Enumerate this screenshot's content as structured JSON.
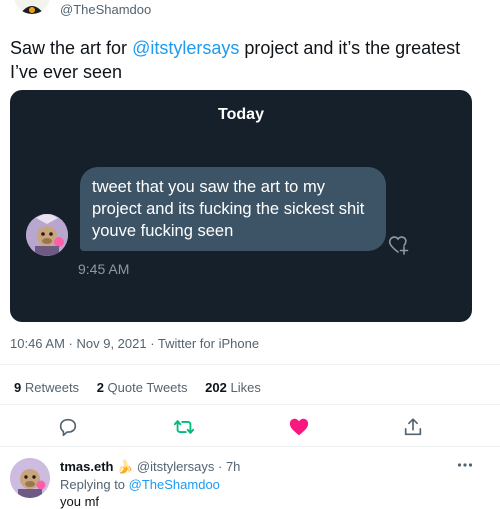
{
  "tweet": {
    "handle": "@TheShamdoo",
    "text_prefix": "Saw the art for ",
    "mention": "@itstylersays",
    "text_suffix": " project and it’s the greatest I’ve ever seen",
    "meta": "10:46 AM · Nov 9, 2021 · Twitter for iPhone"
  },
  "dm_screenshot": {
    "date_label": "Today",
    "message": "tweet that you saw the art to my project and its fucking the sickest shit youve fucking seen",
    "time": "9:45 AM"
  },
  "stats": {
    "retweets_count": "9",
    "retweets_label": "Retweets",
    "quotes_count": "2",
    "quotes_label": "Quote Tweets",
    "likes_count": "202",
    "likes_label": "Likes"
  },
  "actions": [
    "reply-icon",
    "retweet-icon",
    "like-icon",
    "share-icon"
  ],
  "colors": {
    "accent": "#1d9bf0",
    "retweet": "#00ba7c",
    "like": "#f91880",
    "dm_bg": "#15202b",
    "bubble": "#3d5466"
  },
  "reply": {
    "name": "tmas.eth",
    "emoji": "🍌",
    "handle_time": "@itstylersays · 7h",
    "replying_prefix": "Replying to ",
    "replying_to": "@TheShamdoo",
    "text": "you mf"
  }
}
